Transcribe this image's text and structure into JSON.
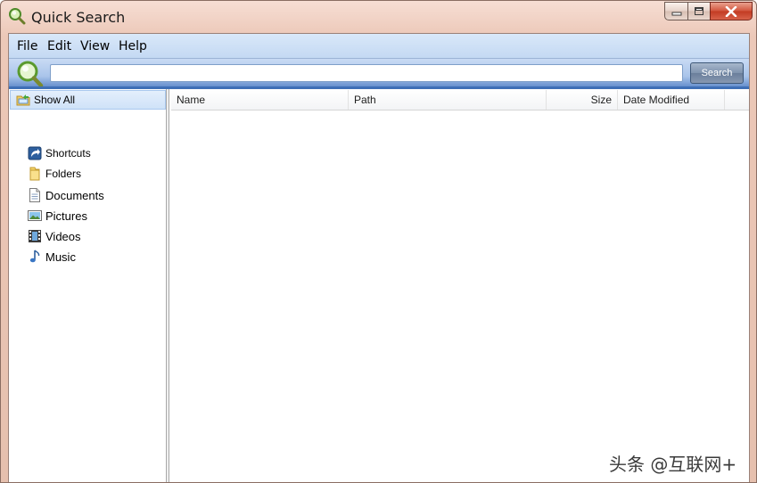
{
  "window": {
    "title": "Quick Search"
  },
  "menu": {
    "items": [
      "File",
      "Edit",
      "View",
      "Help"
    ]
  },
  "search": {
    "value": "",
    "button_label": "Search"
  },
  "filters": [
    {
      "label": "Show All",
      "icon": "show-all-icon",
      "selected": true
    },
    {
      "label": "Shortcuts",
      "icon": "shortcut-icon"
    },
    {
      "label": "Folders",
      "icon": "folder-icon"
    },
    {
      "label": "Documents",
      "icon": "document-icon"
    },
    {
      "label": "Pictures",
      "icon": "picture-icon"
    },
    {
      "label": "Videos",
      "icon": "video-icon"
    },
    {
      "label": "Music",
      "icon": "music-icon"
    }
  ],
  "results": {
    "columns": [
      "Name",
      "Path",
      "Size",
      "Date Modified"
    ]
  },
  "watermark": "头条 @互联网+",
  "colors": {
    "accent": "#3e6fb6",
    "frame": "#ecc8b8",
    "close": "#c23a22"
  }
}
